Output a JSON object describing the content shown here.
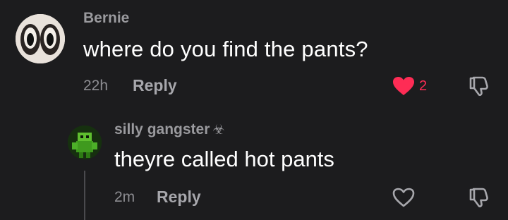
{
  "comment": {
    "author": "Bernie",
    "text": "where do you find the pants?",
    "time": "22h",
    "reply_label": "Reply",
    "like_count": "2",
    "liked": true,
    "like_color": "#fe2c55"
  },
  "reply": {
    "author": "silly gangster",
    "author_icon": "☣",
    "text": "theyre called hot pants",
    "time": "2m",
    "reply_label": "Reply",
    "liked": false
  },
  "colors": {
    "background": "#1c1c1e",
    "text_primary": "#ffffff",
    "text_secondary": "#9a9a9e",
    "accent": "#fe2c55"
  }
}
